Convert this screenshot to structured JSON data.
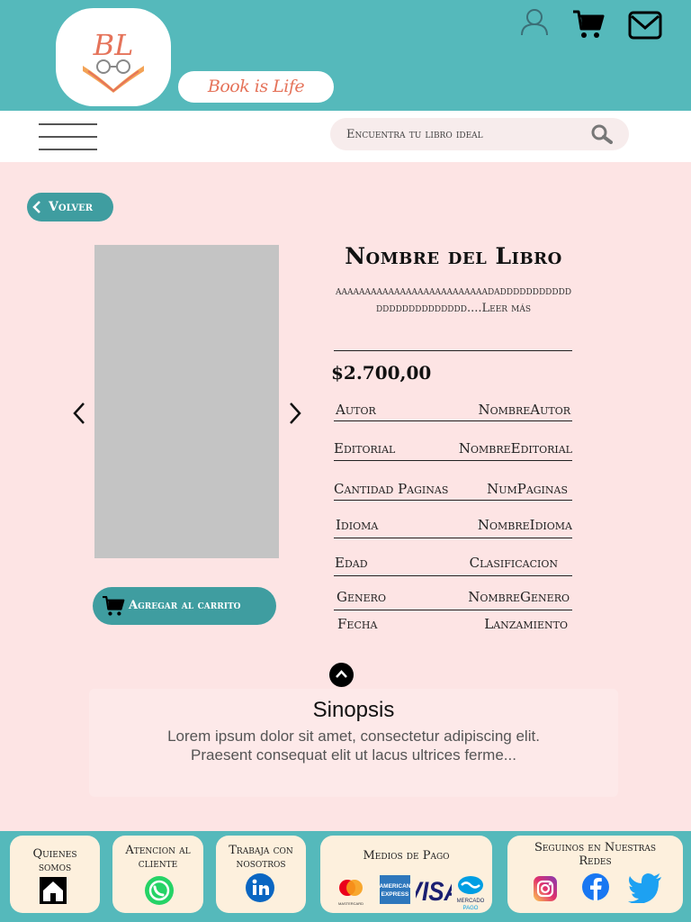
{
  "header": {
    "logo_initials": "BL",
    "brand_name": "Book is Life",
    "icons": [
      "user-icon",
      "cart-icon",
      "mail-icon"
    ]
  },
  "nav": {
    "search_placeholder": "Encuentra tu libro ideal"
  },
  "back_button": "Volver",
  "book": {
    "title": "Nombre del Libro",
    "description": "aaaaaaaaaaaaaaaaaaaaaaaaaadaddddddddddddddddddddddddd....Leer más",
    "price": "$2.700,00",
    "details": [
      {
        "label": "Autor",
        "value": "NombreAutor"
      },
      {
        "label": "Editorial",
        "value": "NombreEditorial"
      },
      {
        "label": "Cantidad Paginas",
        "value": "NumPaginas"
      },
      {
        "label": "Idioma",
        "value": "NombreIdioma"
      },
      {
        "label": "Edad",
        "value": "Clasificacion"
      },
      {
        "label": "Genero",
        "value": "NombreGenero"
      },
      {
        "label": "Fecha",
        "value": "Lanzamiento"
      }
    ]
  },
  "add_to_cart": "Agregar al carrito",
  "synopsis": {
    "title": "Sinopsis",
    "text_line1": "Lorem ipsum dolor sit amet, consectetur adipiscing elit.",
    "text_line2": "Praesent consequat elit ut lacus ultrices ferme..."
  },
  "footer": {
    "about": "Quienes somos",
    "support": "Atencion al cliente",
    "jobs": "Trabaja con nosotros",
    "payments": "Medios de Pago",
    "payment_logos": {
      "mastercard": "mastercard",
      "amex": "AMERICAN EXPRESS",
      "visa": "VISA",
      "mercadopago": "mercado pago"
    },
    "social": "Seguinos en Nuestras Redes",
    "social_icons": [
      "instagram-icon",
      "facebook-icon",
      "twitter-icon"
    ]
  },
  "colors": {
    "teal_header": "#55b9bb",
    "teal_button": "#3f9da0",
    "page_bg": "#fde4e4",
    "brand_text": "#e5735a",
    "card_bg": "#fdf0dd"
  }
}
